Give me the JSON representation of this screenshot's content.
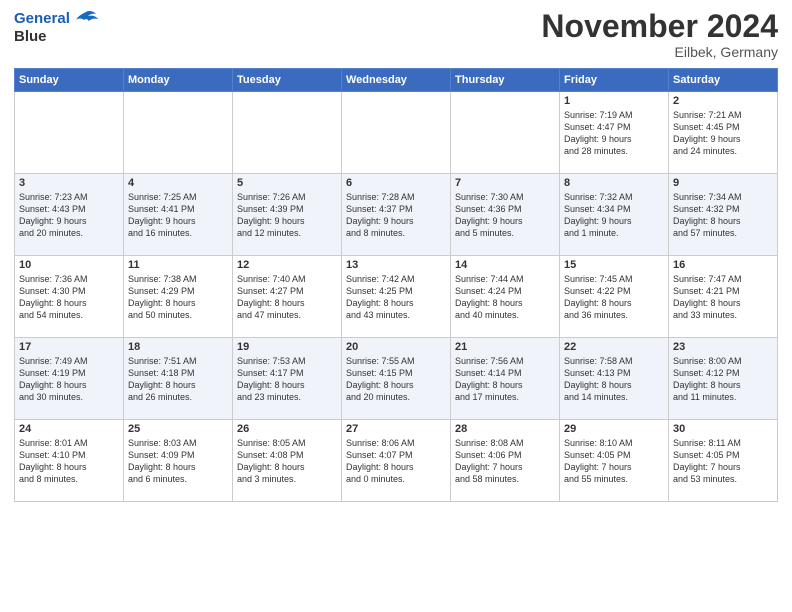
{
  "header": {
    "logo_line1": "General",
    "logo_line2": "Blue",
    "month": "November 2024",
    "location": "Eilbek, Germany"
  },
  "days_of_week": [
    "Sunday",
    "Monday",
    "Tuesday",
    "Wednesday",
    "Thursday",
    "Friday",
    "Saturday"
  ],
  "weeks": [
    [
      {
        "day": "",
        "info": ""
      },
      {
        "day": "",
        "info": ""
      },
      {
        "day": "",
        "info": ""
      },
      {
        "day": "",
        "info": ""
      },
      {
        "day": "",
        "info": ""
      },
      {
        "day": "1",
        "info": "Sunrise: 7:19 AM\nSunset: 4:47 PM\nDaylight: 9 hours\nand 28 minutes."
      },
      {
        "day": "2",
        "info": "Sunrise: 7:21 AM\nSunset: 4:45 PM\nDaylight: 9 hours\nand 24 minutes."
      }
    ],
    [
      {
        "day": "3",
        "info": "Sunrise: 7:23 AM\nSunset: 4:43 PM\nDaylight: 9 hours\nand 20 minutes."
      },
      {
        "day": "4",
        "info": "Sunrise: 7:25 AM\nSunset: 4:41 PM\nDaylight: 9 hours\nand 16 minutes."
      },
      {
        "day": "5",
        "info": "Sunrise: 7:26 AM\nSunset: 4:39 PM\nDaylight: 9 hours\nand 12 minutes."
      },
      {
        "day": "6",
        "info": "Sunrise: 7:28 AM\nSunset: 4:37 PM\nDaylight: 9 hours\nand 8 minutes."
      },
      {
        "day": "7",
        "info": "Sunrise: 7:30 AM\nSunset: 4:36 PM\nDaylight: 9 hours\nand 5 minutes."
      },
      {
        "day": "8",
        "info": "Sunrise: 7:32 AM\nSunset: 4:34 PM\nDaylight: 9 hours\nand 1 minute."
      },
      {
        "day": "9",
        "info": "Sunrise: 7:34 AM\nSunset: 4:32 PM\nDaylight: 8 hours\nand 57 minutes."
      }
    ],
    [
      {
        "day": "10",
        "info": "Sunrise: 7:36 AM\nSunset: 4:30 PM\nDaylight: 8 hours\nand 54 minutes."
      },
      {
        "day": "11",
        "info": "Sunrise: 7:38 AM\nSunset: 4:29 PM\nDaylight: 8 hours\nand 50 minutes."
      },
      {
        "day": "12",
        "info": "Sunrise: 7:40 AM\nSunset: 4:27 PM\nDaylight: 8 hours\nand 47 minutes."
      },
      {
        "day": "13",
        "info": "Sunrise: 7:42 AM\nSunset: 4:25 PM\nDaylight: 8 hours\nand 43 minutes."
      },
      {
        "day": "14",
        "info": "Sunrise: 7:44 AM\nSunset: 4:24 PM\nDaylight: 8 hours\nand 40 minutes."
      },
      {
        "day": "15",
        "info": "Sunrise: 7:45 AM\nSunset: 4:22 PM\nDaylight: 8 hours\nand 36 minutes."
      },
      {
        "day": "16",
        "info": "Sunrise: 7:47 AM\nSunset: 4:21 PM\nDaylight: 8 hours\nand 33 minutes."
      }
    ],
    [
      {
        "day": "17",
        "info": "Sunrise: 7:49 AM\nSunset: 4:19 PM\nDaylight: 8 hours\nand 30 minutes."
      },
      {
        "day": "18",
        "info": "Sunrise: 7:51 AM\nSunset: 4:18 PM\nDaylight: 8 hours\nand 26 minutes."
      },
      {
        "day": "19",
        "info": "Sunrise: 7:53 AM\nSunset: 4:17 PM\nDaylight: 8 hours\nand 23 minutes."
      },
      {
        "day": "20",
        "info": "Sunrise: 7:55 AM\nSunset: 4:15 PM\nDaylight: 8 hours\nand 20 minutes."
      },
      {
        "day": "21",
        "info": "Sunrise: 7:56 AM\nSunset: 4:14 PM\nDaylight: 8 hours\nand 17 minutes."
      },
      {
        "day": "22",
        "info": "Sunrise: 7:58 AM\nSunset: 4:13 PM\nDaylight: 8 hours\nand 14 minutes."
      },
      {
        "day": "23",
        "info": "Sunrise: 8:00 AM\nSunset: 4:12 PM\nDaylight: 8 hours\nand 11 minutes."
      }
    ],
    [
      {
        "day": "24",
        "info": "Sunrise: 8:01 AM\nSunset: 4:10 PM\nDaylight: 8 hours\nand 8 minutes."
      },
      {
        "day": "25",
        "info": "Sunrise: 8:03 AM\nSunset: 4:09 PM\nDaylight: 8 hours\nand 6 minutes."
      },
      {
        "day": "26",
        "info": "Sunrise: 8:05 AM\nSunset: 4:08 PM\nDaylight: 8 hours\nand 3 minutes."
      },
      {
        "day": "27",
        "info": "Sunrise: 8:06 AM\nSunset: 4:07 PM\nDaylight: 8 hours\nand 0 minutes."
      },
      {
        "day": "28",
        "info": "Sunrise: 8:08 AM\nSunset: 4:06 PM\nDaylight: 7 hours\nand 58 minutes."
      },
      {
        "day": "29",
        "info": "Sunrise: 8:10 AM\nSunset: 4:05 PM\nDaylight: 7 hours\nand 55 minutes."
      },
      {
        "day": "30",
        "info": "Sunrise: 8:11 AM\nSunset: 4:05 PM\nDaylight: 7 hours\nand 53 minutes."
      }
    ]
  ]
}
